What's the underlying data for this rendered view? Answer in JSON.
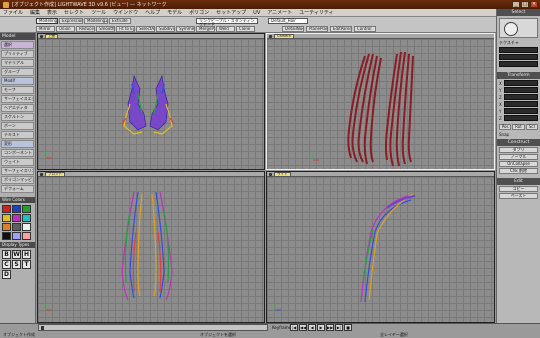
{
  "window": {
    "title": "[オブジェクト作成] LIGHTWAVE 3D v9.6 (ビュー) — ネットワーク",
    "min": "_",
    "max": "□",
    "close": "×"
  },
  "menu": [
    "ファイル",
    "編集",
    "表示",
    "セレクト",
    "ツール",
    "ウインドウ",
    "ヘルプ",
    "モデル",
    "ポリゴン",
    "セットアップ",
    "UV",
    "アニメート",
    "ユーティリティ"
  ],
  "toolbar": {
    "tabs": [
      "Modeling",
      "Expressions",
      "Modeling2",
      "Extrude"
    ],
    "row2": [
      "Mirror",
      "Union",
      "Reduce",
      "Smooth",
      "Fit to Eye",
      "SelectAll",
      "Subdivide",
      "SymmetryOn",
      "MergePoints",
      "Weld",
      "Clone"
    ],
    "layer_select": "リンクピープル・スタンディングモード",
    "object_select": "Default_Hair",
    "right_buttons": [
      "DetailNode",
      "PlanePlane",
      "EditParent",
      "Control"
    ]
  },
  "left_panel": {
    "header": "Model",
    "buttons": [
      "選択",
      "プリミティブ",
      "マテリアル",
      "グループ",
      "Modif",
      "モーフ",
      "サーフェイスエディタ",
      "ヘアエディタ",
      "スケルトン",
      "ボーン",
      "テキスト",
      "変形",
      "コンポーネント",
      "ウェイト",
      "サーフェイスリンク",
      "ポリゴンマッピング",
      "デフォーム"
    ],
    "wire_colors_label": "Wire Colors",
    "wire_colors": [
      "#d02020",
      "#2040c0",
      "#20a030",
      "#e0c020",
      "#c030c0",
      "#20c0c0",
      "#e08020",
      "#606060",
      "#f0f0f0",
      "#101010",
      "#a0a0ff",
      "#ffa0a0"
    ],
    "display_types_label": "Display Types",
    "display_types": [
      "B",
      "W",
      "H",
      "C",
      "S",
      "T",
      "D"
    ]
  },
  "viewports": [
    {
      "name": "上面"
    },
    {
      "name": "Camera"
    },
    {
      "name": "フロント"
    },
    {
      "name": "ライト"
    }
  ],
  "right_panel": {
    "select_header": "Select",
    "fill_label": "テクスチャ",
    "transform_header": "Transform",
    "axes": [
      "X",
      "Y",
      "Z",
      "X",
      "Y",
      "Z"
    ],
    "mode_buttons": [
      "Pos",
      "Rot",
      "Scl"
    ],
    "construct_header": "Construct",
    "construct_buttons": [
      "ダブリ",
      "ノーマル",
      "OnCollapse",
      "Chk 削除"
    ],
    "edit_header": "Edit",
    "edit_buttons": [
      "コピー",
      "ペースト"
    ],
    "snap_label": "Snap"
  },
  "status": {
    "left_text": "オブジェクト作成",
    "frame_label": "Keyframe",
    "middle_text": "オブジェクトを選択",
    "right_text": "全レイヤー選択",
    "play_buttons": [
      "|◀",
      "◀◀",
      "◀",
      "▶",
      "▶▶",
      "▶|",
      "■"
    ]
  }
}
